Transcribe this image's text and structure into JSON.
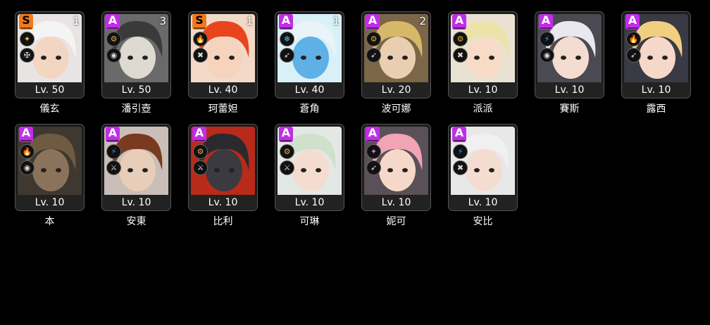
{
  "agents": [
    {
      "name": "儀玄",
      "rank": "S",
      "level": "Lv. 50",
      "dup": "1",
      "attribute": "ether-icon",
      "attr_color": "#f0c040",
      "specialty": "rupture-icon",
      "bg": "#e9e4e4",
      "hair": "#f4f4f4",
      "skin": "#f2d6c2"
    },
    {
      "name": "潘引壺",
      "rank": "A",
      "level": "Lv. 50",
      "dup": "3",
      "attribute": "physical-icon",
      "attr_color": "#e0b040",
      "specialty": "defense-icon",
      "bg": "#6a6a6a",
      "hair": "#3a3a3a",
      "skin": "#dedad2"
    },
    {
      "name": "珂蕾妲",
      "rank": "S",
      "level": "Lv. 40",
      "dup": "1",
      "attribute": "fire-icon",
      "attr_color": "#ff4b1f",
      "specialty": "stun-icon",
      "bg": "#f2d9c8",
      "hair": "#e8451e",
      "skin": "#f6d3bd"
    },
    {
      "name": "蒼角",
      "rank": "A",
      "level": "Lv. 40",
      "dup": "1",
      "attribute": "ice-icon",
      "attr_color": "#4ec8f0",
      "specialty": "support-icon",
      "bg": "#d8f0f8",
      "hair": "#e8f4f8",
      "skin": "#5fb0e6"
    },
    {
      "name": "波可娜",
      "rank": "A",
      "level": "Lv. 20",
      "dup": "2",
      "attribute": "physical-icon",
      "attr_color": "#e0b040",
      "specialty": "support-icon",
      "bg": "#7b6648",
      "hair": "#d7b868",
      "skin": "#e9cfb0"
    },
    {
      "name": "派派",
      "rank": "A",
      "level": "Lv. 10",
      "dup": "",
      "attribute": "physical-icon",
      "attr_color": "#e0b040",
      "specialty": "stun-icon",
      "bg": "#e9e2d2",
      "hair": "#ece3a8",
      "skin": "#f6dcc6"
    },
    {
      "name": "賽斯",
      "rank": "A",
      "level": "Lv. 10",
      "dup": "",
      "attribute": "electric-icon",
      "attr_color": "#3aa4ff",
      "specialty": "defense-icon",
      "bg": "#4a4a52",
      "hair": "#e8e8ee",
      "skin": "#f4dcd0"
    },
    {
      "name": "露西",
      "rank": "A",
      "level": "Lv. 10",
      "dup": "",
      "attribute": "fire-icon",
      "attr_color": "#ff4b1f",
      "specialty": "support-icon",
      "bg": "#3a3a44",
      "hair": "#f0d080",
      "skin": "#f6d8c8"
    },
    {
      "name": "本",
      "rank": "A",
      "level": "Lv. 10",
      "dup": "",
      "attribute": "fire-icon",
      "attr_color": "#ff4b1f",
      "specialty": "defense-icon",
      "bg": "#3e3830",
      "hair": "#6f5a42",
      "skin": "#8a735a"
    },
    {
      "name": "安東",
      "rank": "A",
      "level": "Lv. 10",
      "dup": "",
      "attribute": "electric-icon",
      "attr_color": "#3aa4ff",
      "specialty": "attack-icon",
      "bg": "#c9bfb8",
      "hair": "#7a3a20",
      "skin": "#e8cdb8"
    },
    {
      "name": "比利",
      "rank": "A",
      "level": "Lv. 10",
      "dup": "",
      "attribute": "physical-icon",
      "attr_color": "#e0b040",
      "specialty": "attack-icon",
      "bg": "#b82a1a",
      "hair": "#2a2a2e",
      "skin": "#3a3a40"
    },
    {
      "name": "可琳",
      "rank": "A",
      "level": "Lv. 10",
      "dup": "",
      "attribute": "physical-icon",
      "attr_color": "#e0b040",
      "specialty": "attack-icon",
      "bg": "#e4e8e4",
      "hair": "#cfe0cc",
      "skin": "#f4dcd0"
    },
    {
      "name": "妮可",
      "rank": "A",
      "level": "Lv. 10",
      "dup": "",
      "attribute": "ether-icon",
      "attr_color": "#d070f0",
      "specialty": "support-icon",
      "bg": "#5a5058",
      "hair": "#f0a4b4",
      "skin": "#f6d8c8"
    },
    {
      "name": "安比",
      "rank": "A",
      "level": "Lv. 10",
      "dup": "",
      "attribute": "electric-icon",
      "attr_color": "#3aa4ff",
      "specialty": "stun-icon",
      "bg": "#e8e8e8",
      "hair": "#f0f0f0",
      "skin": "#f4dcd0"
    }
  ]
}
